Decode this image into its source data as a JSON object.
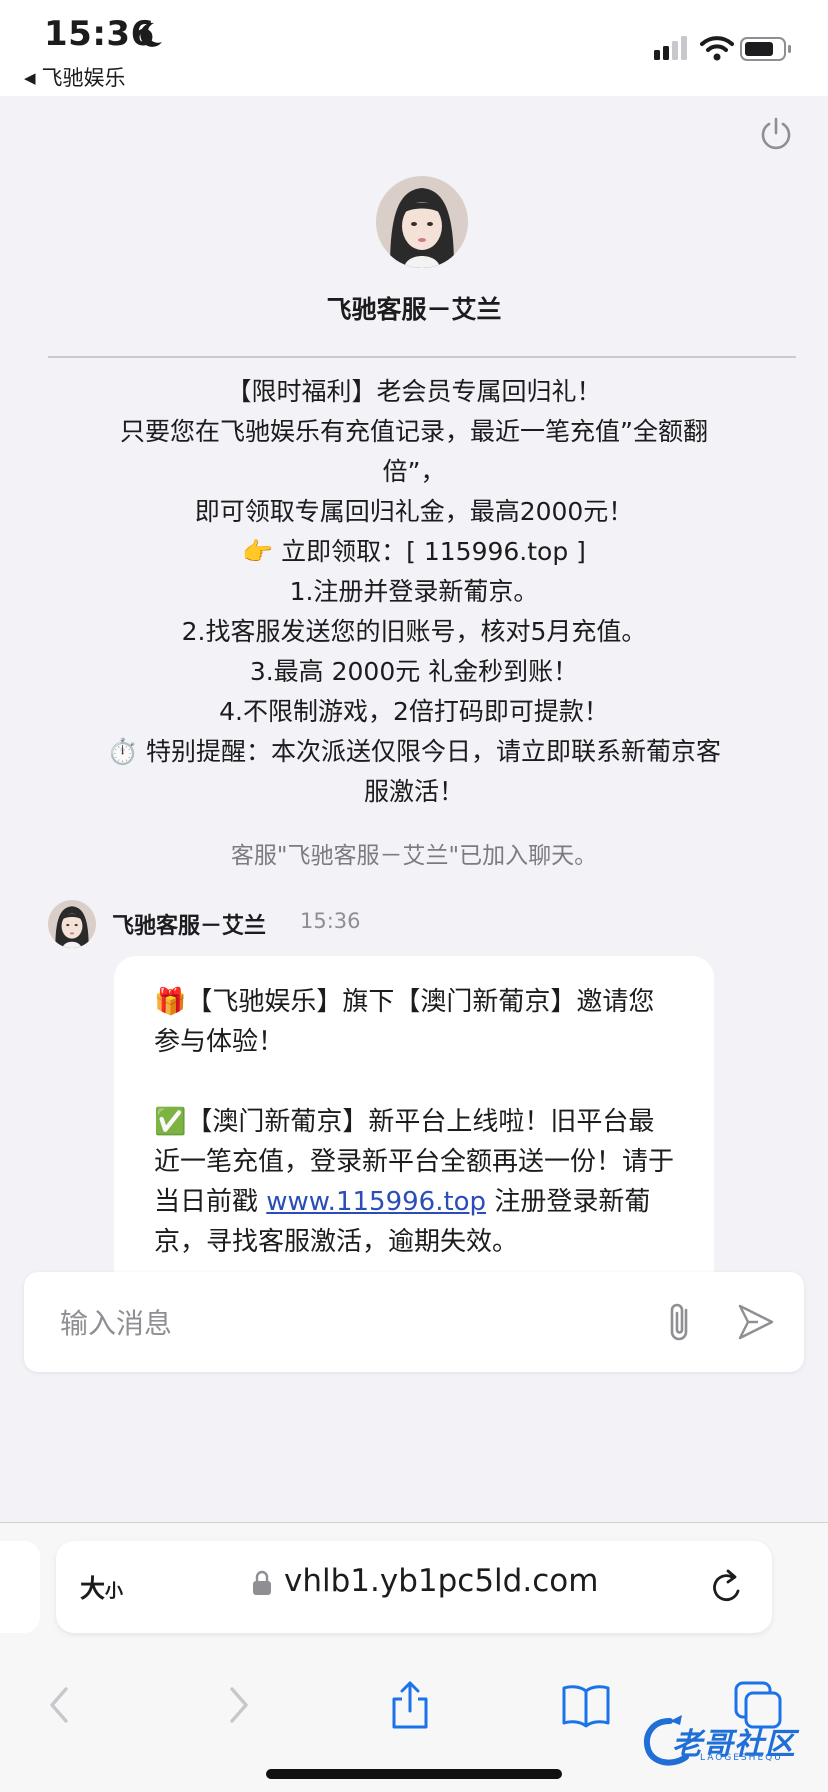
{
  "status_bar": {
    "time": "15:36",
    "back_app": "飞驰娱乐"
  },
  "agent": {
    "name": "飞驰客服－艾兰"
  },
  "announcement": {
    "lines": [
      "【限时福利】老会员专属回归礼！",
      "只要您在飞驰娱乐有充值记录，最近一笔充值”全额翻",
      "倍”，",
      "即可领取专属回归礼金，最高2000元！",
      "👉 立即领取：[ 115996.top ]",
      "1.注册并登录新葡京。",
      "2.找客服发送您的旧账号，核对5月充值。",
      "3.最高 2000元 礼金秒到账！",
      "4.不限制游戏，2倍打码即可提款！",
      "⏱️ 特别提醒：本次派送仅限今日，请立即联系新葡京客",
      "服激活！"
    ]
  },
  "system_note": "客服\"飞驰客服－艾兰\"已加入聊天。",
  "message": {
    "sender": "飞驰客服－艾兰",
    "time": "15:36",
    "para1_emoji": "🎁",
    "para1": "【飞驰娱乐】旗下【澳门新葡京】邀请您参与体验！",
    "para2_emoji": "✅",
    "para2_before_link": "【澳门新葡京】新平台上线啦！旧平台最近一笔充值，登录新平台全额再送一份！请于当日前戳 ",
    "link": "www.115996.top",
    "para2_after_link": " 注册登录新葡京，寻找客服激活，逾期失效。"
  },
  "input": {
    "placeholder": "输入消息"
  },
  "browser": {
    "text_size_big": "大",
    "text_size_small": "小",
    "url": "vhlb1.yb1pc5ld.com"
  },
  "watermark": {
    "text": "老哥社区",
    "sub": "LAOGESHEQU"
  },
  "colors": {
    "link": "#2a4db8",
    "background": "#f2f2f7",
    "toolbar_accent": "#1a73e8"
  }
}
